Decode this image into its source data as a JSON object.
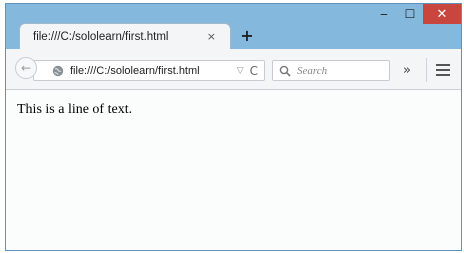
{
  "window": {
    "controls": {
      "minimize": "‒",
      "maximize": "☐",
      "close": "✕"
    }
  },
  "tab": {
    "title": "file:///C:/sololearn/first.html",
    "close_glyph": "×"
  },
  "new_tab": {
    "glyph": "+"
  },
  "navbar": {
    "back_glyph": "←",
    "url": "file:///C:/sololearn/first.html",
    "dropdown_glyph": "▽",
    "reload_glyph": "C",
    "search_placeholder": "Search",
    "overflow_glyph": "»"
  },
  "page": {
    "text": "This is a line of text."
  },
  "colors": {
    "titlebar": "#85b8dd",
    "close_button": "#c9463e",
    "toolbar": "#f3f5f7",
    "page_background": "#fbfdfc"
  }
}
